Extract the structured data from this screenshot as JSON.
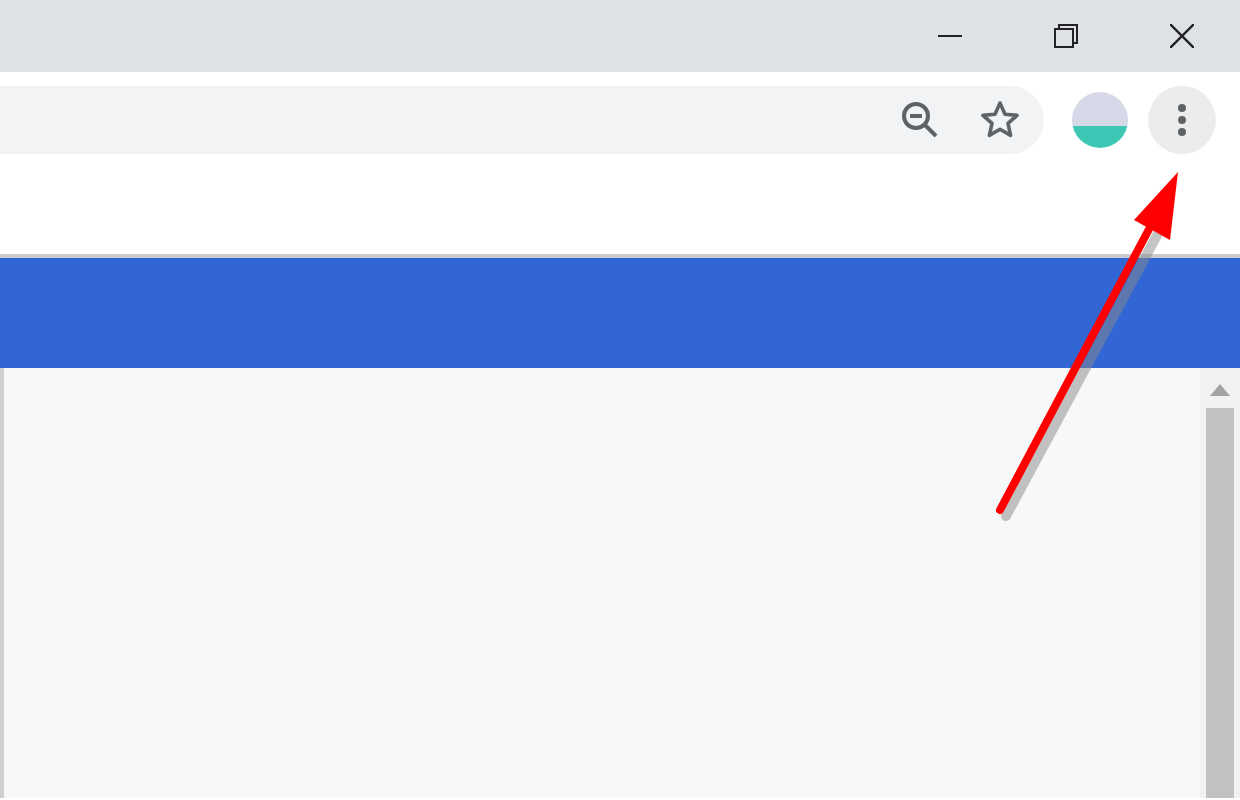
{
  "annotation": {
    "kind": "arrow"
  }
}
